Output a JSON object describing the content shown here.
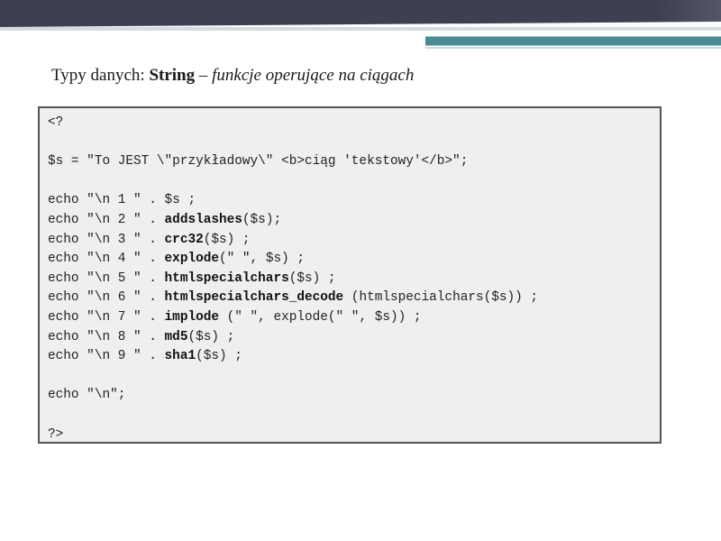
{
  "title": {
    "prefix": "Typy danych: ",
    "bold": "String",
    "dash": " – ",
    "italic": "funkcje operujące na ciągach"
  },
  "code": [
    {
      "parts": [
        {
          "t": "<?",
          "b": false
        }
      ]
    },
    {
      "parts": []
    },
    {
      "parts": [
        {
          "t": "$s = \"To JEST \\\"przykładowy\\\" <b>ciąg 'tekstowy'</b>\";",
          "b": false
        }
      ]
    },
    {
      "parts": []
    },
    {
      "parts": [
        {
          "t": "echo \"\\n 1 \" . $s ;",
          "b": false
        }
      ]
    },
    {
      "parts": [
        {
          "t": "echo \"\\n 2 \" . ",
          "b": false
        },
        {
          "t": "addslashes",
          "b": true
        },
        {
          "t": "($s);",
          "b": false
        }
      ]
    },
    {
      "parts": [
        {
          "t": "echo \"\\n 3 \" . ",
          "b": false
        },
        {
          "t": "crc32",
          "b": true
        },
        {
          "t": "($s) ;",
          "b": false
        }
      ]
    },
    {
      "parts": [
        {
          "t": "echo \"\\n 4 \" . ",
          "b": false
        },
        {
          "t": "explode",
          "b": true
        },
        {
          "t": "(\" \", $s) ;",
          "b": false
        }
      ]
    },
    {
      "parts": [
        {
          "t": "echo \"\\n 5 \" . ",
          "b": false
        },
        {
          "t": "htmlspecialchars",
          "b": true
        },
        {
          "t": "($s) ;",
          "b": false
        }
      ]
    },
    {
      "parts": [
        {
          "t": "echo \"\\n 6 \" . ",
          "b": false
        },
        {
          "t": "htmlspecialchars_decode",
          "b": true
        },
        {
          "t": " (htmlspecialchars($s)) ;",
          "b": false
        }
      ]
    },
    {
      "parts": [
        {
          "t": "echo \"\\n 7 \" . ",
          "b": false
        },
        {
          "t": "implode",
          "b": true
        },
        {
          "t": " (\" \", explode(\" \", $s)) ;",
          "b": false
        }
      ]
    },
    {
      "parts": [
        {
          "t": "echo \"\\n 8 \" . ",
          "b": false
        },
        {
          "t": "md5",
          "b": true
        },
        {
          "t": "($s) ;",
          "b": false
        }
      ]
    },
    {
      "parts": [
        {
          "t": "echo \"\\n 9 \" . ",
          "b": false
        },
        {
          "t": "sha1",
          "b": true
        },
        {
          "t": "($s) ;",
          "b": false
        }
      ]
    },
    {
      "parts": []
    },
    {
      "parts": [
        {
          "t": "echo \"\\n\";",
          "b": false
        }
      ]
    },
    {
      "parts": []
    },
    {
      "parts": [
        {
          "t": "?>",
          "b": false
        }
      ]
    }
  ],
  "colors": {
    "header_dark": "#3e3f52",
    "header_teal": "#4a8a94",
    "code_bg": "#efefef",
    "code_border": "#555555"
  }
}
